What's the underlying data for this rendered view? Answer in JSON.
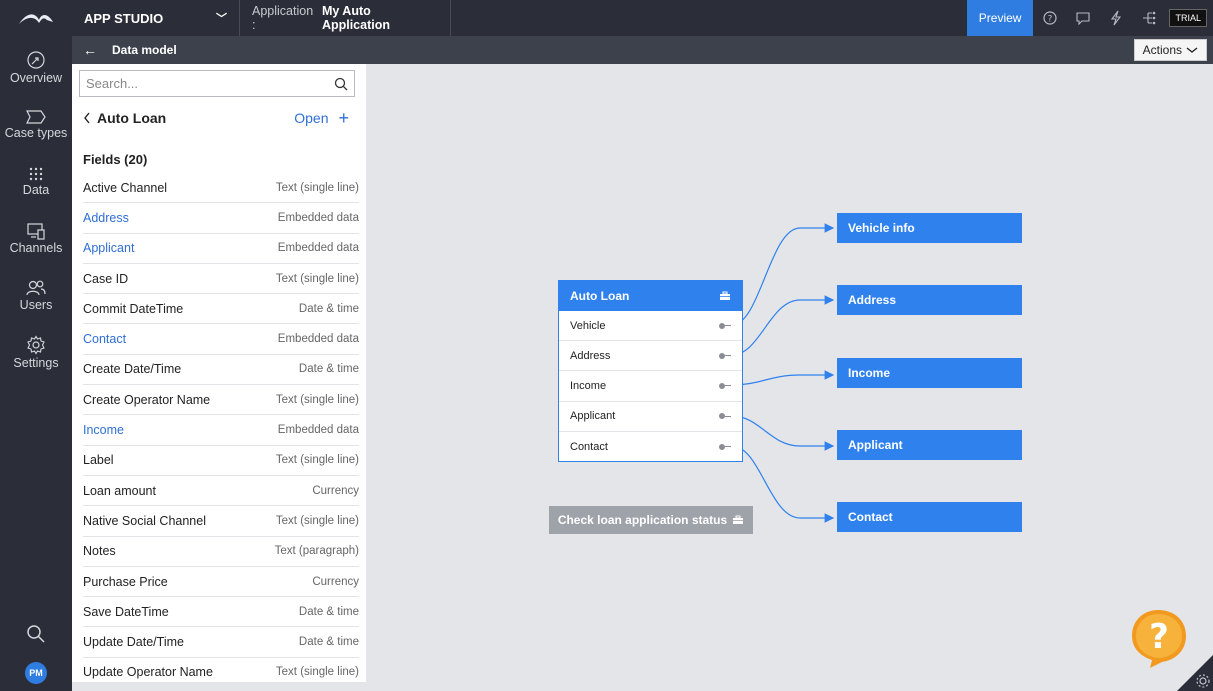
{
  "topbar": {
    "studio": "APP STUDIO",
    "app_label": "Application :",
    "app_name": "My Auto Application",
    "preview": "Preview",
    "trial": "TRIAL"
  },
  "subbar": {
    "title": "Data model",
    "actions": "Actions"
  },
  "nav": {
    "items": [
      {
        "label": "Overview",
        "icon": "overview-icon"
      },
      {
        "label": "Case types",
        "icon": "case-types-icon"
      },
      {
        "label": "Data",
        "icon": "data-icon"
      },
      {
        "label": "Channels",
        "icon": "channels-icon"
      },
      {
        "label": "Users",
        "icon": "users-icon"
      },
      {
        "label": "Settings",
        "icon": "settings-icon"
      }
    ],
    "avatar": "PM"
  },
  "panel": {
    "search_placeholder": "Search...",
    "entity": "Auto Loan",
    "open": "Open",
    "fields_heading": "Fields (20)",
    "fields": [
      {
        "name": "Active Channel",
        "type": "Text (single line)",
        "link": false
      },
      {
        "name": "Address",
        "type": "Embedded data",
        "link": true
      },
      {
        "name": "Applicant",
        "type": "Embedded data",
        "link": true
      },
      {
        "name": "Case ID",
        "type": "Text (single line)",
        "link": false
      },
      {
        "name": "Commit DateTime",
        "type": "Date & time",
        "link": false
      },
      {
        "name": "Contact",
        "type": "Embedded data",
        "link": true
      },
      {
        "name": "Create Date/Time",
        "type": "Date & time",
        "link": false
      },
      {
        "name": "Create Operator Name",
        "type": "Text (single line)",
        "link": false
      },
      {
        "name": "Income",
        "type": "Embedded data",
        "link": true
      },
      {
        "name": "Label",
        "type": "Text (single line)",
        "link": false
      },
      {
        "name": "Loan amount",
        "type": "Currency",
        "link": false
      },
      {
        "name": "Native Social Channel",
        "type": "Text (single line)",
        "link": false
      },
      {
        "name": "Notes",
        "type": "Text (paragraph)",
        "link": false
      },
      {
        "name": "Purchase Price",
        "type": "Currency",
        "link": false
      },
      {
        "name": "Save DateTime",
        "type": "Date & time",
        "link": false
      },
      {
        "name": "Update Date/Time",
        "type": "Date & time",
        "link": false
      },
      {
        "name": "Update Operator Name",
        "type": "Text (single line)",
        "link": false
      }
    ]
  },
  "diagram": {
    "source": "Auto Loan",
    "rows": [
      "Vehicle",
      "Address",
      "Income",
      "Applicant",
      "Contact"
    ],
    "targets": [
      "Vehicle info",
      "Address",
      "Income",
      "Applicant",
      "Contact"
    ],
    "check_button": "Check loan application status",
    "accent": "#2f82ee"
  }
}
